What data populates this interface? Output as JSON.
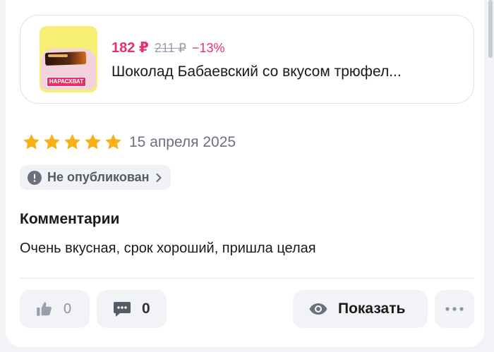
{
  "product": {
    "badge": "НАРАСХВАТ",
    "price_now": "182 ₽",
    "price_old": "211 ₽",
    "discount": "−13%",
    "title": "Шоколад Бабаевский со вкусом трюфел..."
  },
  "review": {
    "rating": 5,
    "date": "15 апреля 2025",
    "status": "Не опубликован",
    "comments_title": "Комментарии",
    "comment": "Очень вкусная, срок хороший, пришла целая"
  },
  "actions": {
    "likes": "0",
    "comments_count": "0",
    "show_label": "Показать"
  },
  "colors": {
    "accent": "#e8316b",
    "star": "#f7b119"
  },
  "icons": {
    "star": "star-icon",
    "warning": "warning-icon",
    "chevron": "chevron-right-icon",
    "like": "thumbs-up-icon",
    "comment": "comment-icon",
    "eye": "eye-icon",
    "more": "more-icon"
  }
}
